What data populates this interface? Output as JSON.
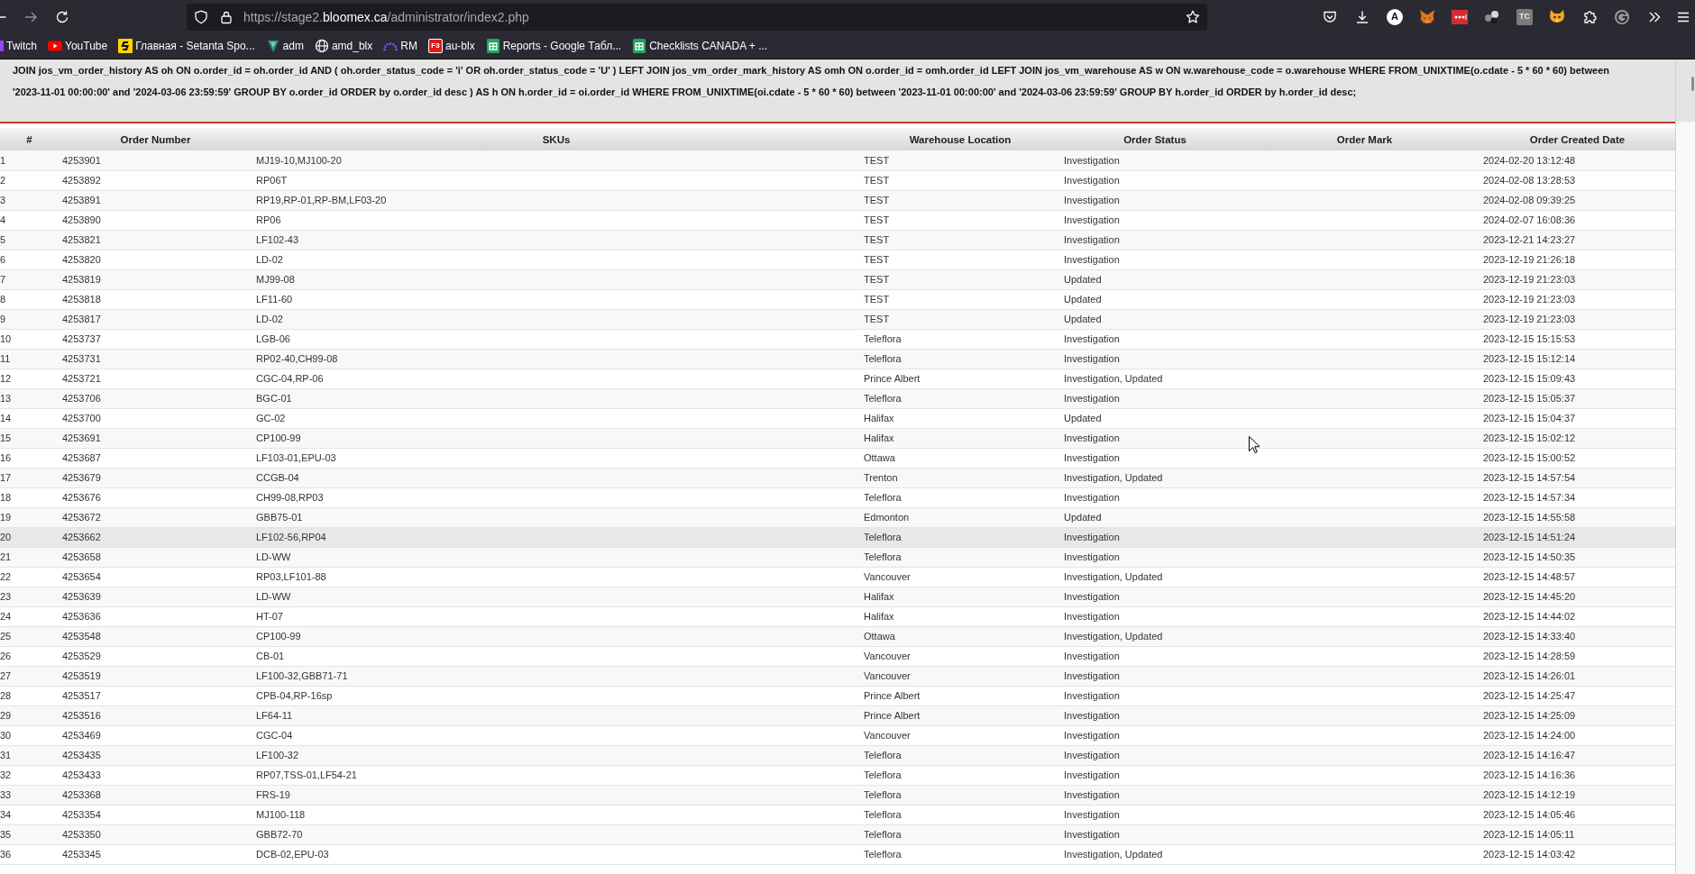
{
  "browser": {
    "address": {
      "scheme_host": "https://stage2.",
      "domain": "bloomex.ca",
      "path": "/administrator/index2.php"
    },
    "extensions": [
      {
        "kind": "chevron-shield"
      },
      {
        "kind": "download"
      },
      {
        "kind": "letter",
        "label": "A"
      },
      {
        "kind": "fox"
      },
      {
        "kind": "dots"
      },
      {
        "kind": "spheres"
      },
      {
        "kind": "tile",
        "label": "TC"
      },
      {
        "kind": "cat"
      },
      {
        "kind": "puzzle"
      },
      {
        "kind": "ring"
      },
      {
        "kind": "overflow"
      },
      {
        "kind": "menu"
      }
    ],
    "bookmarks": [
      {
        "kind": "fragment",
        "label": "Twitch"
      },
      {
        "kind": "play",
        "label": "YouTube"
      },
      {
        "kind": "square-logo",
        "label": "Главная - Setanta Spo..."
      },
      {
        "kind": "triangle",
        "label": "adm"
      },
      {
        "kind": "globe",
        "label": "amd_blx"
      },
      {
        "kind": "dotted-arc",
        "label": "RM"
      },
      {
        "kind": "tile",
        "icon_text": "F3",
        "label": "au-blx"
      },
      {
        "kind": "sheet",
        "label": "Reports - Google Табл..."
      },
      {
        "kind": "sheet",
        "label": "Checklists CANADA + ..."
      }
    ]
  },
  "query": {
    "lines": [
      "JOIN jos_vm_order_history AS oh ON o.order_id = oh.order_id AND ( oh.order_status_code = 'i' OR oh.order_status_code = 'U' ) LEFT JOIN jos_vm_order_mark_history AS omh ON o.order_id = omh.order_id LEFT JOIN jos_vm_warehouse AS w ON w.warehouse_code = o.warehouse WHERE FROM_UNIXTIME(o.cdate - 5 * 60 * 60) between",
      "'2023-11-01 00:00:00' and '2024-03-06 23:59:59' GROUP BY o.order_id ORDER by o.order_id desc ) AS h ON h.order_id = oi.order_id WHERE FROM_UNIXTIME(oi.cdate - 5 * 60 * 60) between '2023-11-01 00:00:00' and '2024-03-06 23:59:59' GROUP BY h.order_id ORDER by h.order_id desc;"
    ]
  },
  "table": {
    "columns": [
      "#",
      "Order Number",
      "SKUs",
      "Warehouse Location",
      "Order Status",
      "Order Mark",
      "Order Created Date"
    ],
    "rows": [
      {
        "number": "1",
        "order_number": "4253901",
        "skus": "MJ19-10,MJ100-20",
        "warehouse": "TEST",
        "status": "Investigation",
        "created": "2024-02-20 13:12:48",
        "highlighted": false
      },
      {
        "number": "2",
        "order_number": "4253892",
        "skus": "RP06T",
        "warehouse": "TEST",
        "status": "Investigation",
        "created": "2024-02-08 13:28:53",
        "highlighted": false
      },
      {
        "number": "3",
        "order_number": "4253891",
        "skus": "RP19,RP-01,RP-BM,LF03-20",
        "warehouse": "TEST",
        "status": "Investigation",
        "created": "2024-02-08 09:39:25",
        "highlighted": false
      },
      {
        "number": "4",
        "order_number": "4253890",
        "skus": "RP06",
        "warehouse": "TEST",
        "status": "Investigation",
        "created": "2024-02-07 16:08:36",
        "highlighted": false
      },
      {
        "number": "5",
        "order_number": "4253821",
        "skus": "LF102-43",
        "warehouse": "TEST",
        "status": "Investigation",
        "created": "2023-12-21 14:23:27",
        "highlighted": false
      },
      {
        "number": "6",
        "order_number": "4253820",
        "skus": "LD-02",
        "warehouse": "TEST",
        "status": "Investigation",
        "created": "2023-12-19 21:26:18",
        "highlighted": false
      },
      {
        "number": "7",
        "order_number": "4253819",
        "skus": "MJ99-08",
        "warehouse": "TEST",
        "status": "Updated",
        "created": "2023-12-19 21:23:03",
        "highlighted": false
      },
      {
        "number": "8",
        "order_number": "4253818",
        "skus": "LF11-60",
        "warehouse": "TEST",
        "status": "Updated",
        "created": "2023-12-19 21:23:03",
        "highlighted": false
      },
      {
        "number": "9",
        "order_number": "4253817",
        "skus": "LD-02",
        "warehouse": "TEST",
        "status": "Updated",
        "created": "2023-12-19 21:23:03",
        "highlighted": false
      },
      {
        "number": "10",
        "order_number": "4253737",
        "skus": "LGB-06",
        "warehouse": "Teleflora",
        "status": "Investigation",
        "created": "2023-12-15 15:15:53",
        "highlighted": false
      },
      {
        "number": "11",
        "order_number": "4253731",
        "skus": "RP02-40,CH99-08",
        "warehouse": "Teleflora",
        "status": "Investigation",
        "created": "2023-12-15 15:12:14",
        "highlighted": false
      },
      {
        "number": "12",
        "order_number": "4253721",
        "skus": "CGC-04,RP-06",
        "warehouse": "Prince Albert",
        "status": "Investigation, Updated",
        "created": "2023-12-15 15:09:43",
        "highlighted": false
      },
      {
        "number": "13",
        "order_number": "4253706",
        "skus": "BGC-01",
        "warehouse": "Teleflora",
        "status": "Investigation",
        "created": "2023-12-15 15:05:37",
        "highlighted": false
      },
      {
        "number": "14",
        "order_number": "4253700",
        "skus": "GC-02",
        "warehouse": "Halifax",
        "status": "Updated",
        "created": "2023-12-15 15:04:37",
        "highlighted": false
      },
      {
        "number": "15",
        "order_number": "4253691",
        "skus": "CP100-99",
        "warehouse": "Halifax",
        "status": "Investigation",
        "created": "2023-12-15 15:02:12",
        "highlighted": false
      },
      {
        "number": "16",
        "order_number": "4253687",
        "skus": "LF103-01,EPU-03",
        "warehouse": "Ottawa",
        "status": "Investigation",
        "created": "2023-12-15 15:00:52",
        "highlighted": false
      },
      {
        "number": "17",
        "order_number": "4253679",
        "skus": "CCGB-04",
        "warehouse": "Trenton",
        "status": "Investigation, Updated",
        "created": "2023-12-15 14:57:54",
        "highlighted": false
      },
      {
        "number": "18",
        "order_number": "4253676",
        "skus": "CH99-08,RP03",
        "warehouse": "Teleflora",
        "status": "Investigation",
        "created": "2023-12-15 14:57:34",
        "highlighted": false
      },
      {
        "number": "19",
        "order_number": "4253672",
        "skus": "GBB75-01",
        "warehouse": "Edmonton",
        "status": "Updated",
        "created": "2023-12-15 14:55:58",
        "highlighted": false
      },
      {
        "number": "20",
        "order_number": "4253662",
        "skus": "LF102-56,RP04",
        "warehouse": "Teleflora",
        "status": "Investigation",
        "created": "2023-12-15 14:51:24",
        "highlighted": true
      },
      {
        "number": "21",
        "order_number": "4253658",
        "skus": "LD-WW",
        "warehouse": "Teleflora",
        "status": "Investigation",
        "created": "2023-12-15 14:50:35",
        "highlighted": false
      },
      {
        "number": "22",
        "order_number": "4253654",
        "skus": "RP03,LF101-88",
        "warehouse": "Vancouver",
        "status": "Investigation, Updated",
        "created": "2023-12-15 14:48:57",
        "highlighted": false
      },
      {
        "number": "23",
        "order_number": "4253639",
        "skus": "LD-WW",
        "warehouse": "Halifax",
        "status": "Investigation",
        "created": "2023-12-15 14:45:20",
        "highlighted": false
      },
      {
        "number": "24",
        "order_number": "4253636",
        "skus": "HT-07",
        "warehouse": "Halifax",
        "status": "Investigation",
        "created": "2023-12-15 14:44:02",
        "highlighted": false
      },
      {
        "number": "25",
        "order_number": "4253548",
        "skus": "CP100-99",
        "warehouse": "Ottawa",
        "status": "Investigation, Updated",
        "created": "2023-12-15 14:33:40",
        "highlighted": false
      },
      {
        "number": "26",
        "order_number": "4253529",
        "skus": "CB-01",
        "warehouse": "Vancouver",
        "status": "Investigation",
        "created": "2023-12-15 14:28:59",
        "highlighted": false
      },
      {
        "number": "27",
        "order_number": "4253519",
        "skus": "LF100-32,GBB71-71",
        "warehouse": "Vancouver",
        "status": "Investigation",
        "created": "2023-12-15 14:26:01",
        "highlighted": false
      },
      {
        "number": "28",
        "order_number": "4253517",
        "skus": "CPB-04,RP-16sp",
        "warehouse": "Prince Albert",
        "status": "Investigation",
        "created": "2023-12-15 14:25:47",
        "highlighted": false
      },
      {
        "number": "29",
        "order_number": "4253516",
        "skus": "LF64-11",
        "warehouse": "Prince Albert",
        "status": "Investigation",
        "created": "2023-12-15 14:25:09",
        "highlighted": false
      },
      {
        "number": "30",
        "order_number": "4253469",
        "skus": "CGC-04",
        "warehouse": "Vancouver",
        "status": "Investigation",
        "created": "2023-12-15 14:24:00",
        "highlighted": false
      },
      {
        "number": "31",
        "order_number": "4253435",
        "skus": "LF100-32",
        "warehouse": "Teleflora",
        "status": "Investigation",
        "created": "2023-12-15 14:16:47",
        "highlighted": false
      },
      {
        "number": "32",
        "order_number": "4253433",
        "skus": "RP07,TSS-01,LF54-21",
        "warehouse": "Teleflora",
        "status": "Investigation",
        "created": "2023-12-15 14:16:36",
        "highlighted": false
      },
      {
        "number": "33",
        "order_number": "4253368",
        "skus": "FRS-19",
        "warehouse": "Teleflora",
        "status": "Investigation",
        "created": "2023-12-15 14:12:19",
        "highlighted": false
      },
      {
        "number": "34",
        "order_number": "4253354",
        "skus": "MJ100-118",
        "warehouse": "Teleflora",
        "status": "Investigation",
        "created": "2023-12-15 14:05:46",
        "highlighted": false
      },
      {
        "number": "35",
        "order_number": "4253350",
        "skus": "GBB72-70",
        "warehouse": "Teleflora",
        "status": "Investigation",
        "created": "2023-12-15 14:05:11",
        "highlighted": false
      },
      {
        "number": "36",
        "order_number": "4253345",
        "skus": "DCB-02,EPU-03",
        "warehouse": "Teleflora",
        "status": "Investigation, Updated",
        "created": "2023-12-15 14:03:42",
        "highlighted": false
      }
    ]
  }
}
